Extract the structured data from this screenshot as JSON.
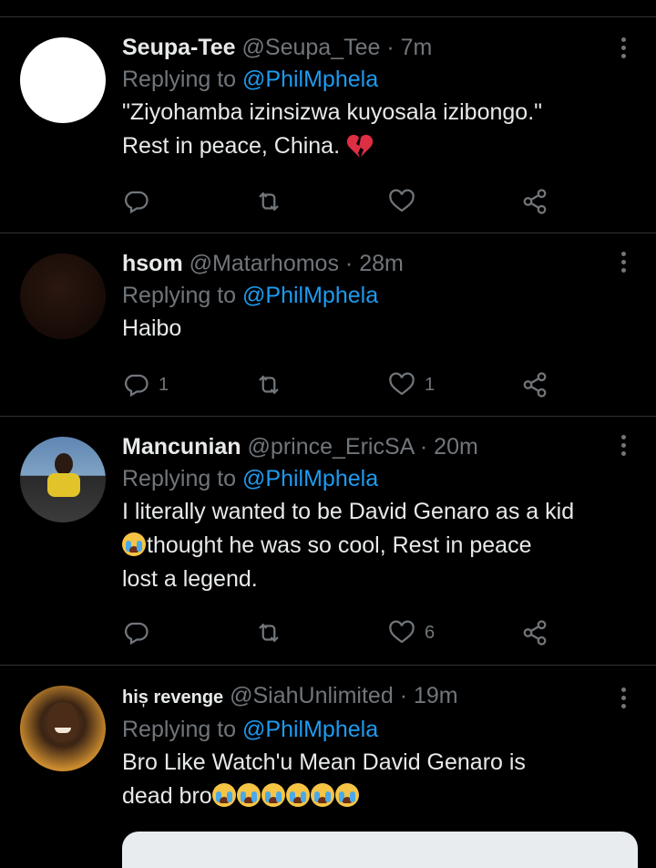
{
  "tweets": [
    {
      "name": "Seupa-Tee",
      "handle": "@Seupa_Tee",
      "dot": "·",
      "time": "7m",
      "replying_prefix": "Replying to",
      "replying_to": "@PhilMphela",
      "lines": [
        "\"Ziyohamba izinsizwa kuyosala izibongo.\"",
        "Rest in peace, China."
      ],
      "reply_count": "",
      "like_count": ""
    },
    {
      "name": "hsom",
      "handle": "@Matarhomos",
      "dot": "·",
      "time": "28m",
      "replying_prefix": "Replying to",
      "replying_to": "@PhilMphela",
      "lines": [
        "Haibo"
      ],
      "reply_count": "1",
      "like_count": "1"
    },
    {
      "name": "Mancunian",
      "handle": "@prince_EricSA",
      "dot": "·",
      "time": "20m",
      "replying_prefix": "Replying to",
      "replying_to": "@PhilMphela",
      "lines": [
        "I literally wanted to be David Genaro as a kid",
        "thought he was so cool, Rest in peace",
        "lost a legend."
      ],
      "reply_count": "",
      "like_count": "6"
    },
    {
      "name": "his̩ revenge",
      "handle": "@SiahUnlimited",
      "dot": "·",
      "time": "19m",
      "replying_prefix": "Replying to",
      "replying_to": "@PhilMphela",
      "lines": [
        "Bro Like Watch'u Mean David Genaro is",
        "dead bro"
      ],
      "reply_count": "",
      "like_count": ""
    }
  ],
  "icons": {
    "reply": "reply-icon",
    "retweet": "retweet-icon",
    "like": "like-icon",
    "share": "share-icon",
    "more": "more-icon",
    "broken_heart": "broken-heart-emoji",
    "crying": "loudly-crying-face-emoji"
  },
  "colors": {
    "background": "#000000",
    "text": "#e7e9ea",
    "secondary": "#71767b",
    "mention": "#1d9bf0",
    "divider": "#2f3336"
  }
}
